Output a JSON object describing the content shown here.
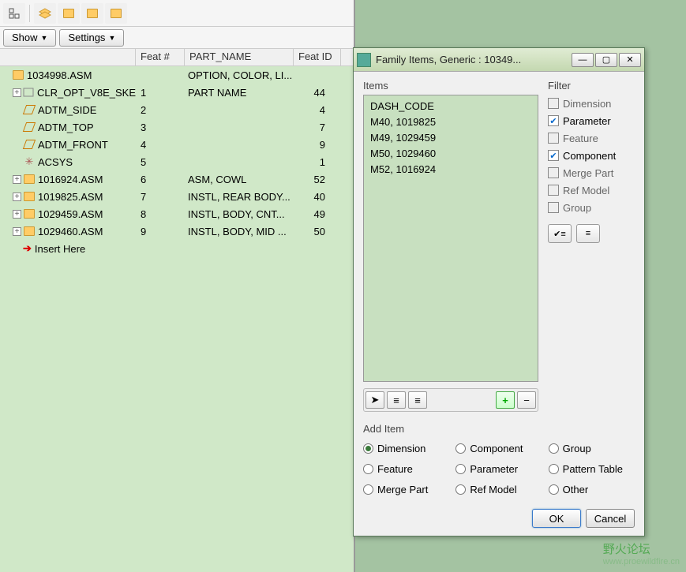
{
  "toolbar": {
    "show_label": "Show",
    "settings_label": "Settings"
  },
  "columns": {
    "feat_num": "Feat #",
    "part_name": "PART_NAME",
    "feat_id": "Feat ID"
  },
  "tree": [
    {
      "level": 0,
      "exp": "",
      "icon": "asm",
      "label": "1034998.ASM",
      "featnum": "",
      "partname": "OPTION, COLOR, LI...",
      "featid": ""
    },
    {
      "level": 1,
      "exp": "+",
      "icon": "sketch",
      "label": "CLR_OPT_V8E_SKE",
      "featnum": "1",
      "partname": "PART NAME",
      "featid": "44"
    },
    {
      "level": 1,
      "exp": "",
      "icon": "datum",
      "label": "ADTM_SIDE",
      "featnum": "2",
      "partname": "",
      "featid": "4"
    },
    {
      "level": 1,
      "exp": "",
      "icon": "datum",
      "label": "ADTM_TOP",
      "featnum": "3",
      "partname": "",
      "featid": "7"
    },
    {
      "level": 1,
      "exp": "",
      "icon": "datum",
      "label": "ADTM_FRONT",
      "featnum": "4",
      "partname": "",
      "featid": "9"
    },
    {
      "level": 1,
      "exp": "",
      "icon": "csys",
      "label": "ACSYS",
      "featnum": "5",
      "partname": "",
      "featid": "1"
    },
    {
      "level": 1,
      "exp": "+",
      "icon": "asm",
      "label": "1016924.ASM",
      "featnum": "6",
      "partname": "ASM, COWL",
      "featid": "52"
    },
    {
      "level": 1,
      "exp": "+",
      "icon": "asm",
      "label": "1019825.ASM",
      "featnum": "7",
      "partname": "INSTL, REAR BODY...",
      "featid": "40"
    },
    {
      "level": 1,
      "exp": "+",
      "icon": "asm",
      "label": "1029459.ASM",
      "featnum": "8",
      "partname": "INSTL, BODY, CNT...",
      "featid": "49"
    },
    {
      "level": 1,
      "exp": "+",
      "icon": "asm",
      "label": "1029460.ASM",
      "featnum": "9",
      "partname": "INSTL, BODY, MID ...",
      "featid": "50"
    },
    {
      "level": 1,
      "exp": "",
      "icon": "insert",
      "label": "Insert Here",
      "featnum": "",
      "partname": "",
      "featid": ""
    }
  ],
  "dialog": {
    "title": "Family Items,  Generic : 10349...",
    "items_label": "Items",
    "filter_label": "Filter",
    "items": [
      "DASH_CODE",
      "M40, 1019825",
      "M49, 1029459",
      "M50, 1029460",
      "M52, 1016924"
    ],
    "filters": [
      {
        "label": "Dimension",
        "checked": false,
        "enabled": false
      },
      {
        "label": "Parameter",
        "checked": true,
        "enabled": true
      },
      {
        "label": "Feature",
        "checked": false,
        "enabled": false
      },
      {
        "label": "Component",
        "checked": true,
        "enabled": true
      },
      {
        "label": "Merge Part",
        "checked": false,
        "enabled": false
      },
      {
        "label": "Ref Model",
        "checked": false,
        "enabled": false
      },
      {
        "label": "Group",
        "checked": false,
        "enabled": false
      }
    ],
    "add_label": "Add Item",
    "radios": [
      {
        "label": "Dimension",
        "sel": true
      },
      {
        "label": "Component",
        "sel": false
      },
      {
        "label": "Group",
        "sel": false
      },
      {
        "label": "Feature",
        "sel": false
      },
      {
        "label": "Parameter",
        "sel": false
      },
      {
        "label": "Pattern Table",
        "sel": false
      },
      {
        "label": "Merge Part",
        "sel": false
      },
      {
        "label": "Ref Model",
        "sel": false
      },
      {
        "label": "Other",
        "sel": false
      }
    ],
    "ok_label": "OK",
    "cancel_label": "Cancel"
  },
  "watermark": {
    "cn": "野火论坛",
    "url": "www.proewildfire.cn"
  }
}
